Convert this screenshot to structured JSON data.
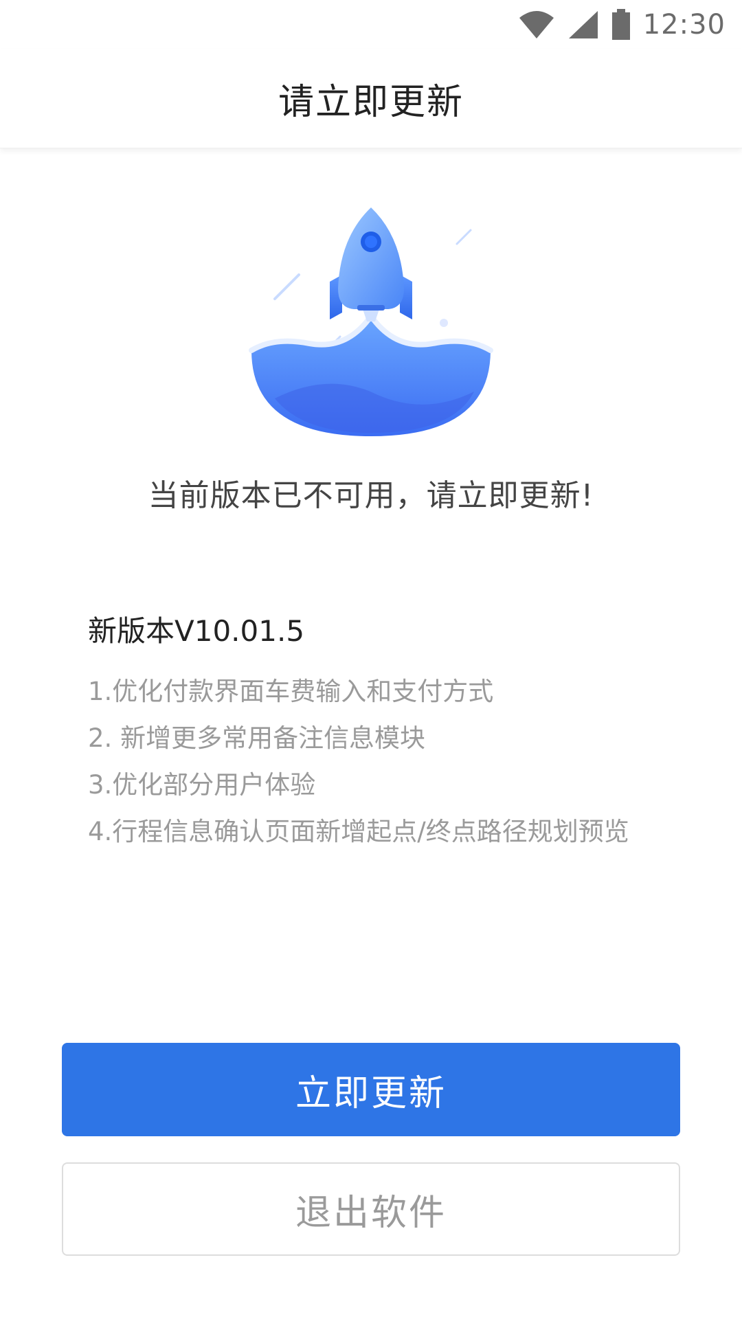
{
  "status_bar": {
    "time": "12:30",
    "icons": [
      "wifi-icon",
      "cellular-signal-icon",
      "battery-icon"
    ]
  },
  "header": {
    "title": "请立即更新"
  },
  "illustration": {
    "icon": "rocket-launch-illustration"
  },
  "notice_text": "当前版本已不可用，请立即更新!",
  "version_label": "新版本V10.01.5",
  "release_notes": [
    "1.优化付款界面车费输入和支付方式",
    "2. 新增更多常用备注信息模块",
    "3.优化部分用户体验",
    "4.行程信息确认页面新增起点/终点路径规划预览"
  ],
  "buttons": {
    "update_now": "立即更新",
    "exit_app": "退出软件"
  },
  "colors": {
    "primary": "#2e75e6",
    "illustration_blue": "#4a86f7"
  }
}
